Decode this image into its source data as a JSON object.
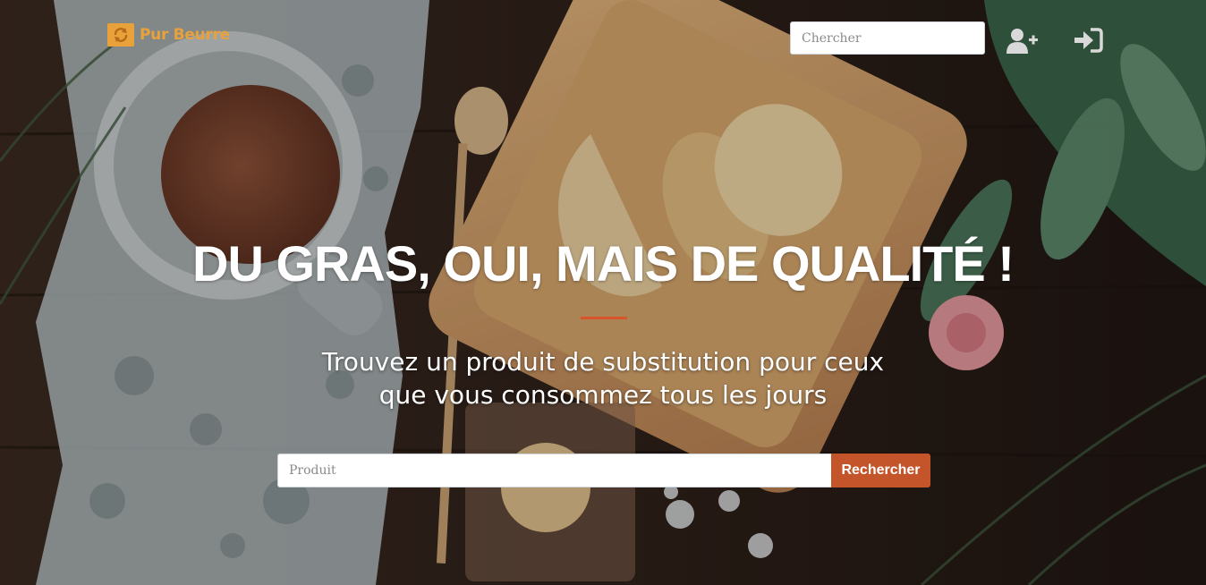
{
  "brand": {
    "name": "Pur Beurre",
    "color": "#e9a23b"
  },
  "navbar": {
    "search_placeholder": "Chercher",
    "icons": [
      "user-plus-icon",
      "sign-in-icon"
    ]
  },
  "hero": {
    "headline": "DU GRAS, OUI, MAIS DE QUALITÉ !",
    "subtitle_line1": "Trouvez un produit de substitution pour ceux",
    "subtitle_line2": "que vous consommez tous les jours",
    "accent_color": "#d9532b"
  },
  "search_form": {
    "product_placeholder": "Produit",
    "button_label": "Rechercher",
    "button_color": "#c4542a"
  }
}
